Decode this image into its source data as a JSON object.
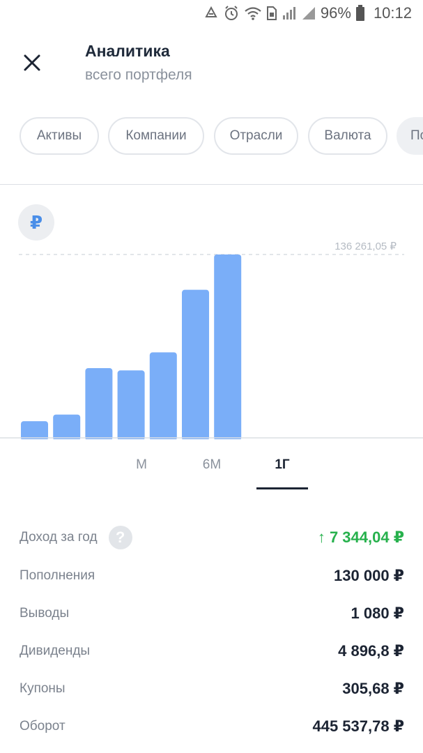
{
  "status_bar": {
    "battery": "96%",
    "time": "10:12",
    "icons": [
      "recycle-icon",
      "alarm-icon",
      "wifi-icon",
      "sim-icon",
      "signal-icon",
      "signal-icon",
      "battery-icon"
    ]
  },
  "header": {
    "title": "Аналитика",
    "subtitle": "всего портфеля",
    "close_icon": "close-icon"
  },
  "chips": [
    {
      "label": "Активы"
    },
    {
      "label": "Компании"
    },
    {
      "label": "Отрасли"
    },
    {
      "label": "Валюта"
    },
    {
      "label": "По"
    }
  ],
  "chart": {
    "currency_symbol": "₽",
    "max_label": "136 261,05 ₽",
    "bar_color": "#7aaef8"
  },
  "chart_data": {
    "type": "bar",
    "values": [
      12400,
      17300,
      51800,
      50100,
      63500,
      110000,
      136261.05
    ],
    "ylim": [
      0,
      136261.05
    ],
    "max_label": "136 261,05 ₽"
  },
  "tabs": [
    {
      "label": "М",
      "active": false
    },
    {
      "label": "6М",
      "active": false
    },
    {
      "label": "1Г",
      "active": true
    }
  ],
  "stats": [
    {
      "label": "Доход за год",
      "value": "↑ 7 344,04 ₽",
      "positive": true,
      "help": true
    },
    {
      "label": "Пополнения",
      "value": "130 000 ₽"
    },
    {
      "label": "Выводы",
      "value": "1 080 ₽"
    },
    {
      "label": "Дивиденды",
      "value": "4 896,8 ₽"
    },
    {
      "label": "Купоны",
      "value": "305,68 ₽"
    },
    {
      "label": "Оборот",
      "value": "445 537,78 ₽"
    }
  ],
  "colors": {
    "accent_blue": "#4a8ee8",
    "positive_green": "#27b14d",
    "text_dark": "#1c2433",
    "text_muted": "#7b828d"
  }
}
